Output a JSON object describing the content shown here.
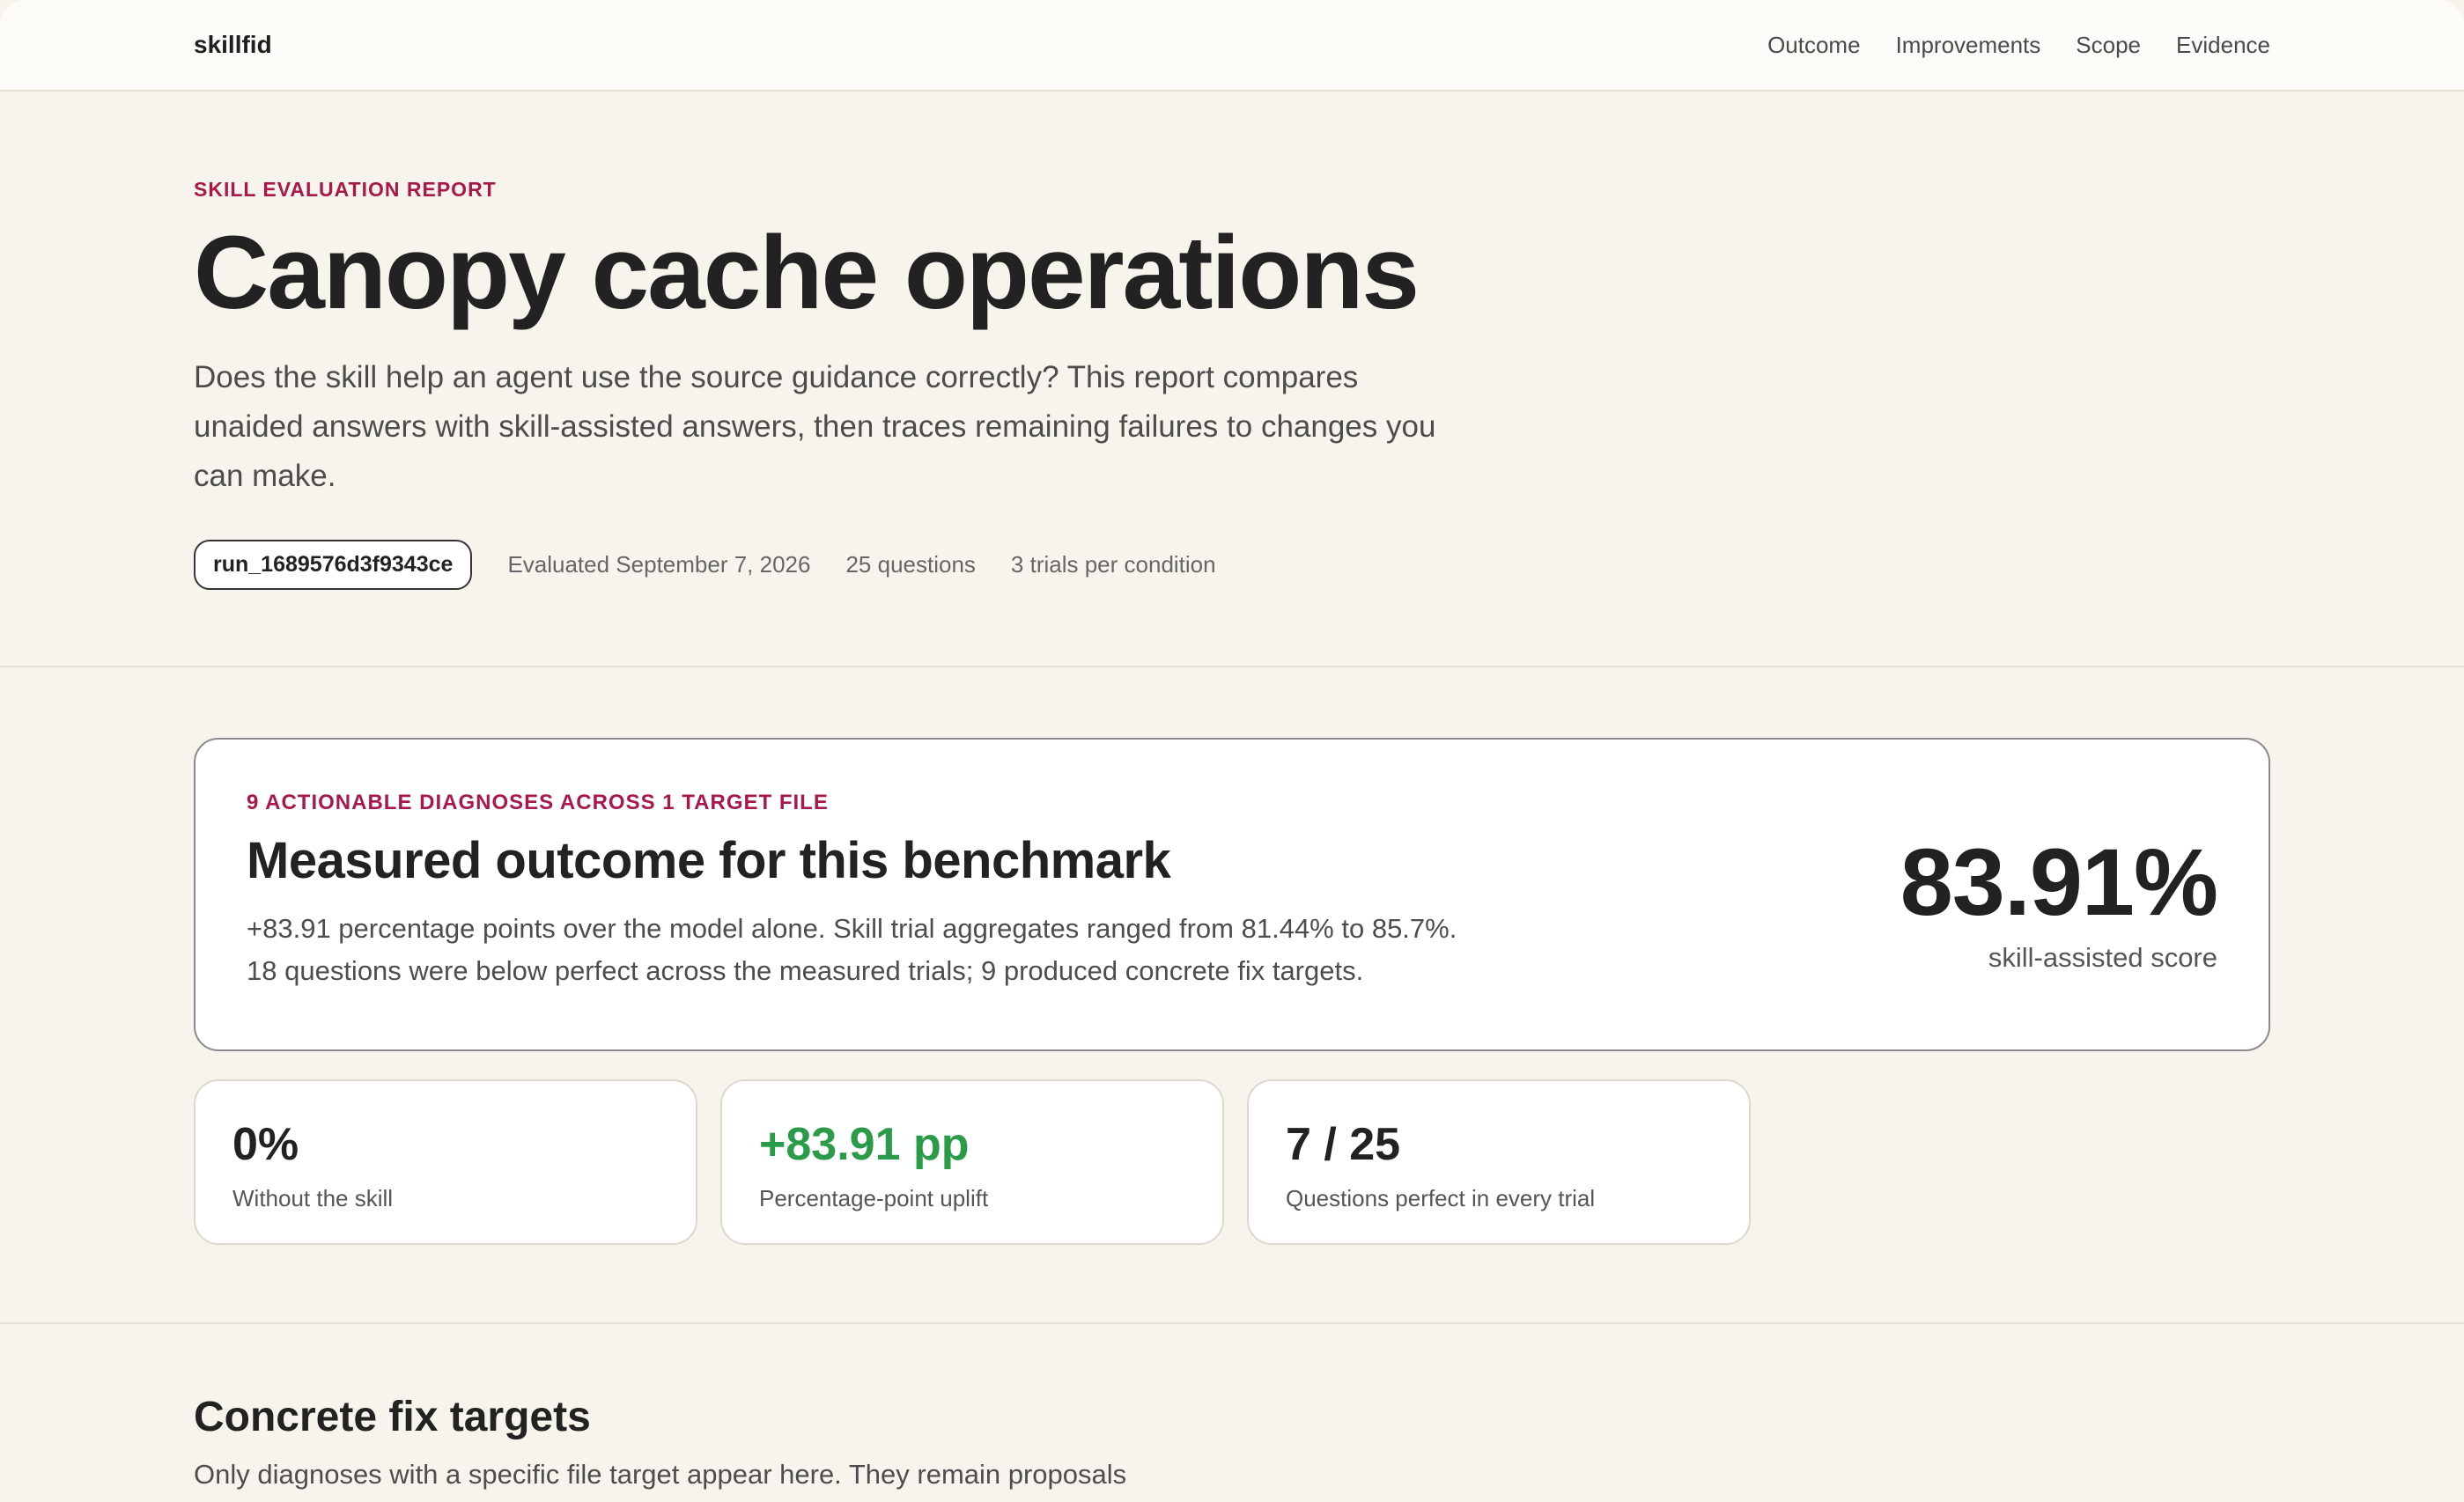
{
  "nav": {
    "brand": "skillfid",
    "links": [
      "Outcome",
      "Improvements",
      "Scope",
      "Evidence"
    ]
  },
  "hero": {
    "eyebrow": "SKILL EVALUATION REPORT",
    "title": "Canopy cache operations",
    "lede": "Does the skill help an agent use the source guidance correctly? This report compares unaided answers with skill-assisted answers, then traces remaining failures to changes you can make.",
    "run_id": "run_1689576d3f9343ce",
    "evaluated": "Evaluated September 7, 2026",
    "questions": "25 questions",
    "trials": "3 trials per condition"
  },
  "outcome": {
    "eyebrow": "9 ACTIONABLE DIAGNOSES ACROSS 1 TARGET FILE",
    "title": "Measured outcome for this benchmark",
    "line1": "+83.91 percentage points over the model alone. Skill trial aggregates ranged from 81.44% to 85.7%.",
    "line2": "18 questions were below perfect across the measured trials; 9 produced concrete fix targets.",
    "score": "83.91%",
    "score_label": "skill-assisted score",
    "stats": [
      {
        "value": "0%",
        "label": "Without the skill"
      },
      {
        "value": "+83.91 pp",
        "label": "Percentage-point uplift"
      },
      {
        "value": "7 / 25",
        "label": "Questions perfect in every trial"
      }
    ]
  },
  "fix": {
    "title": "Concrete fix targets",
    "subtitle": "Only diagnoses with a specific file target appear here. They remain proposals"
  },
  "colors": {
    "background": "#f7f4ed",
    "accent": "#a8194a",
    "positive": "#2a9b48"
  }
}
